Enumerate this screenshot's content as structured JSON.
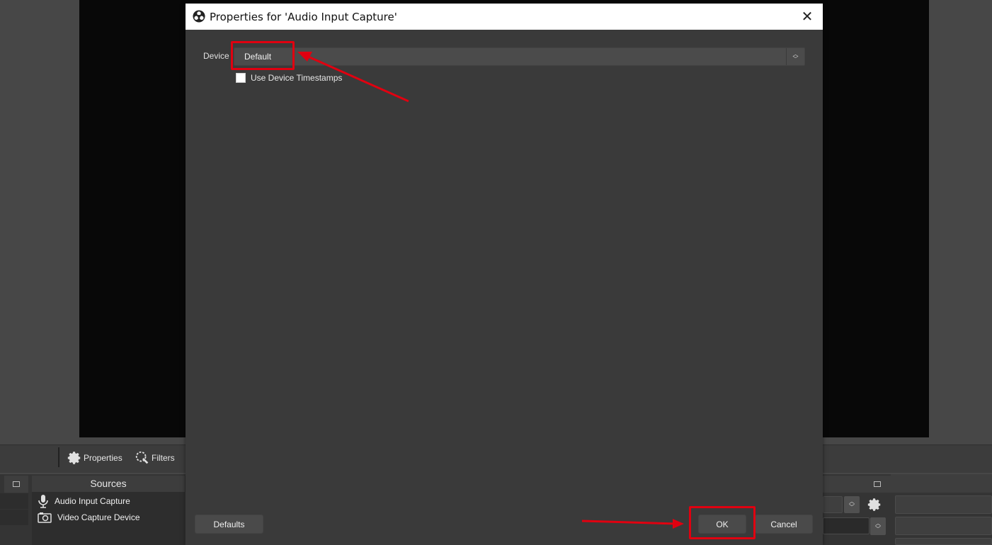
{
  "dialog": {
    "title": "Properties for 'Audio Input Capture'",
    "close_glyph": "✕",
    "device_label": "Device",
    "device_value": "Default",
    "timestamps_label": "Use Device Timestamps",
    "timestamps_checked": false,
    "defaults_label": "Defaults",
    "ok_label": "OK",
    "cancel_label": "Cancel"
  },
  "toolbar": {
    "properties_label": "Properties",
    "filters_label": "Filters"
  },
  "sources": {
    "title": "Sources",
    "items": [
      {
        "label": "Audio Input Capture",
        "icon": "microphone-icon"
      },
      {
        "label": "Video Capture Device",
        "icon": "camera-icon"
      }
    ]
  },
  "colors": {
    "annotation": "#e00010",
    "dialog_bg": "#3a3a3a",
    "preview_bg": "#080808"
  }
}
